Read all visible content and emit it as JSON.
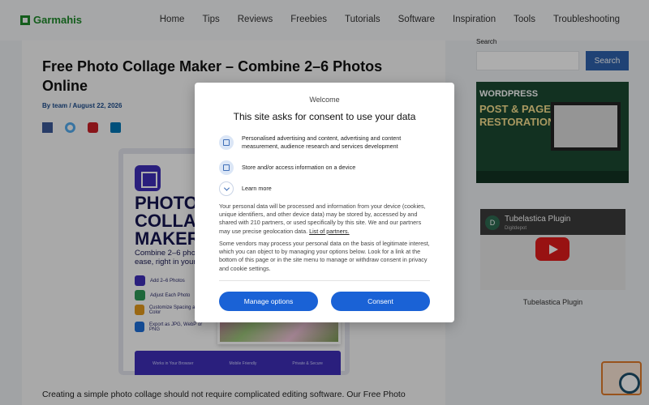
{
  "header": {
    "logo_text": "Garmahis",
    "nav": [
      "Home",
      "Tips",
      "Reviews",
      "Freebies",
      "Tutorials",
      "Software",
      "Inspiration",
      "Tools",
      "Troubleshooting"
    ]
  },
  "article": {
    "title": "Free Photo Collage Maker – Combine 2–6 Photos Online",
    "byline": "By team / August 22, 2026",
    "hero": {
      "heading_lines": [
        "PHOTO",
        "COLLAGE",
        "MAKER"
      ],
      "subtitle": "Combine 2–6 photos with ease, right in your browser.",
      "features": [
        "Add 2–6 Photos",
        "Adjust Each Photo",
        "Customize Spacing and Color",
        "Export as JPG, WebP or PNG"
      ],
      "bar": [
        "Works in Your Browser",
        "Mobile Friendly",
        "Private & Secure"
      ]
    },
    "paragraph": "Creating a simple photo collage should not require complicated editing software. Our Free Photo"
  },
  "sidebar": {
    "search_label": "Search",
    "search_placeholder": "",
    "search_button": "Search",
    "ad": {
      "wp": "WORDPRESS",
      "line1": "POST & PAGE",
      "line2": "RESTORATION"
    },
    "video": {
      "avatar_letter": "D",
      "title": "Tubelastica Plugin",
      "channel": "Digitdepot",
      "caption": "Tubelastica Plugin"
    }
  },
  "consent": {
    "welcome": "Welcome",
    "title": "This site asks for consent to use your data",
    "items": [
      "Personalised advertising and content, advertising and content measurement, audience research and services development",
      "Store and/or access information on a device",
      "Learn more"
    ],
    "body1": "Your personal data will be processed and information from your device (cookies, unique identifiers, and other device data) may be stored by, accessed by and shared with 210 partners, or used specifically by this site. We and our partners may use precise geolocation data.",
    "partners_link": "List of partners.",
    "body2": "Some vendors may process your personal data on the basis of legitimate interest, which you can object to by managing your options below. Look for a link at the bottom of this page or in the site menu to manage or withdraw consent in privacy and cookie settings.",
    "manage_button": "Manage options",
    "consent_button": "Consent"
  },
  "colors": {
    "brand_green": "#1e8a2a",
    "button_blue": "#1a62d6",
    "sidebar_blue": "#2f62ad"
  }
}
